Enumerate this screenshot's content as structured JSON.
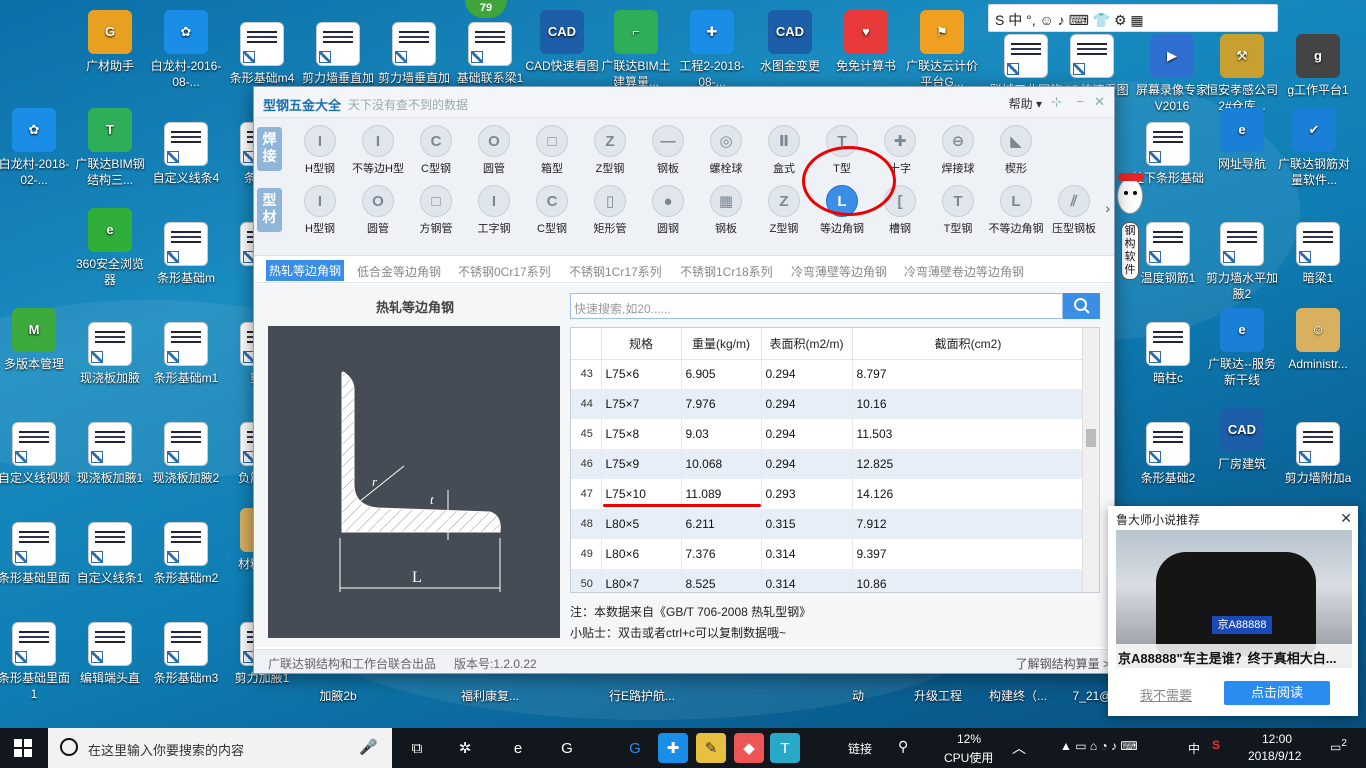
{
  "desktop_icons": [
    {
      "label": "广材助手",
      "color": "#e8a020",
      "glyph": "G"
    },
    {
      "label": "白龙村-2016-08-...",
      "color": "#1a8ee6",
      "glyph": "✿"
    },
    {
      "label": "条形基础m4",
      "thumb": true
    },
    {
      "label": "剪力墙垂直加腋2c",
      "thumb": true
    },
    {
      "label": "剪力墙垂直加腋2c",
      "thumb": true
    },
    {
      "label": "基础联系梁1",
      "thumb": true
    },
    {
      "label": "CAD快速看图",
      "color": "#1d5ea8",
      "glyph": "CAD"
    },
    {
      "label": "广联达BIM土建算量...",
      "color": "#2fae5a",
      "glyph": "⌐"
    },
    {
      "label": "工程2-2018-08-...",
      "color": "#1a8ee6",
      "glyph": "✚"
    },
    {
      "label": "水图金变更",
      "color": "#1d5ea8",
      "glyph": "CAD"
    },
    {
      "label": "免免计算书",
      "color": "#e83a3a",
      "glyph": "♥"
    },
    {
      "label": "广联达云计价平台G...",
      "color": "#f0a020",
      "glyph": "⚑"
    },
    {
      "label": "联城工业园施工图...",
      "thumb": true
    },
    {
      "label": "CAD快速看图",
      "thumb": true
    },
    {
      "label": "屏幕录像专家V2016",
      "color": "#2f6fd0",
      "glyph": "▶"
    },
    {
      "label": "恒安孝感公司2#仓库...",
      "color": "#c8a030",
      "glyph": "⚒"
    },
    {
      "label": "g工作平台1",
      "color": "#444",
      "glyph": "g"
    },
    {
      "label": "白龙村-2018-02-...",
      "color": "#1a8ee6",
      "glyph": "✿"
    },
    {
      "label": "广联达BIM钢结构三...",
      "color": "#2fae5a",
      "glyph": "T"
    },
    {
      "label": "自定义线条4",
      "thumb": true
    },
    {
      "label": "条形基",
      "thumb": true
    },
    {
      "label": "柱下条形基础",
      "thumb": true
    },
    {
      "label": "网址导航",
      "color": "#1a7fd6",
      "glyph": "e"
    },
    {
      "label": "广联达钢筋对量软件...",
      "color": "#1a7fd6",
      "glyph": "✔"
    },
    {
      "label": "360安全浏览器",
      "color": "#2fae3a",
      "glyph": "e"
    },
    {
      "label": "条形基础m",
      "thumb": true
    },
    {
      "label": "回",
      "thumb": true
    },
    {
      "label": "温度钢筋1",
      "thumb": true
    },
    {
      "label": "剪力墙水平加腋2",
      "thumb": true
    },
    {
      "label": "暗梁1",
      "thumb": true
    },
    {
      "label": "多版本管理",
      "color": "#3caa3c",
      "glyph": "M"
    },
    {
      "label": "现浇板加腋",
      "thumb": true
    },
    {
      "label": "条形基础m1",
      "thumb": true
    },
    {
      "label": "剪力",
      "thumb": true
    },
    {
      "label": "暗柱c",
      "thumb": true
    },
    {
      "label": "广联达--服务新干线",
      "color": "#1a7fd6",
      "glyph": "e"
    },
    {
      "label": "Administr...",
      "color": "#d8b060",
      "glyph": "☺"
    },
    {
      "label": "自定义线视频",
      "thumb": true
    },
    {
      "label": "现浇板加腋1",
      "thumb": true
    },
    {
      "label": "现浇板加腋2",
      "thumb": true
    },
    {
      "label": "负筋合支",
      "thumb": true
    },
    {
      "label": "条形基础2",
      "thumb": true
    },
    {
      "label": "厂房建筑",
      "color": "#1d5ea8",
      "glyph": "CAD"
    },
    {
      "label": "剪力墙附加a",
      "thumb": true
    },
    {
      "label": "条形基础里面",
      "thumb": true
    },
    {
      "label": "自定义线条1",
      "thumb": true
    },
    {
      "label": "条形基础m2",
      "thumb": true
    },
    {
      "label": "材料件板",
      "color": "#d8b060",
      "glyph": "▤"
    },
    {
      "label": "条形基础里面1",
      "thumb": true
    },
    {
      "label": "编辑端头直",
      "thumb": true
    },
    {
      "label": "条形基础m3",
      "thumb": true
    },
    {
      "label": "剪力加腋1",
      "thumb": true
    },
    {
      "label": "加腋2b",
      "thumb": false,
      "color": "transparent",
      "glyph": ""
    },
    {
      "label": "福利康复...",
      "thumb": false,
      "color": "transparent",
      "glyph": ""
    },
    {
      "label": "行E路护航...",
      "thumb": false,
      "color": "transparent",
      "glyph": ""
    },
    {
      "label": "动",
      "thumb": false,
      "color": "transparent",
      "glyph": ""
    },
    {
      "label": "升级工程",
      "thumb": false,
      "color": "transparent",
      "glyph": ""
    },
    {
      "label": "构建终（...",
      "thumb": false,
      "color": "transparent",
      "glyph": ""
    },
    {
      "label": "7_21@",
      "thumb": false,
      "color": "transparent",
      "glyph": ""
    }
  ],
  "update_badge": "79",
  "ime_bar": {
    "text": "S 中 °, ☺ ♪ ⌨ 👕 ⚙ ▦"
  },
  "app": {
    "title": "型钢五金大全",
    "subtitle": "天下没有查不到的数据",
    "help": "帮助 ▾",
    "win_buttons": {
      "pin": "⊹",
      "min": "−",
      "close": "✕"
    },
    "row1_tag": "焊接",
    "row2_tag": "型材",
    "row1": [
      {
        "label": "H型钢",
        "glyph": "I"
      },
      {
        "label": "不等边H型",
        "glyph": "I"
      },
      {
        "label": "C型钢",
        "glyph": "C"
      },
      {
        "label": "圆管",
        "glyph": "O"
      },
      {
        "label": "箱型",
        "glyph": "□"
      },
      {
        "label": "Z型钢",
        "glyph": "Z"
      },
      {
        "label": "钢板",
        "glyph": "—"
      },
      {
        "label": "螺栓球",
        "glyph": "◎"
      },
      {
        "label": "盒式",
        "glyph": "Ⅱ"
      },
      {
        "label": "T型",
        "glyph": "T"
      },
      {
        "label": "十字",
        "glyph": "✚"
      },
      {
        "label": "焊接球",
        "glyph": "⊖"
      },
      {
        "label": "楔形",
        "glyph": "◣"
      }
    ],
    "row2": [
      {
        "label": "H型钢",
        "glyph": "I"
      },
      {
        "label": "圆管",
        "glyph": "O"
      },
      {
        "label": "方钢管",
        "glyph": "□"
      },
      {
        "label": "工字钢",
        "glyph": "I"
      },
      {
        "label": "C型钢",
        "glyph": "C"
      },
      {
        "label": "矩形管",
        "glyph": "▯"
      },
      {
        "label": "圆钢",
        "glyph": "●"
      },
      {
        "label": "钢板",
        "glyph": "▦"
      },
      {
        "label": "Z型钢",
        "glyph": "Z"
      },
      {
        "label": "等边角钢",
        "glyph": "L",
        "selected": true
      },
      {
        "label": "槽钢",
        "glyph": "["
      },
      {
        "label": "T型钢",
        "glyph": "T"
      },
      {
        "label": "不等边角钢",
        "glyph": "L"
      },
      {
        "label": "压型钢板",
        "glyph": "⫽"
      }
    ],
    "subtabs": [
      "热轧等边角钢",
      "低合金等边角钢",
      "不锈钢0Cr17系列",
      "不锈钢1Cr17系列",
      "不锈钢1Cr18系列",
      "冷弯薄壁等边角钢",
      "冷弯薄壁卷边等边角钢"
    ],
    "active_subtab": "热轧等边角钢",
    "section_title": "热轧等边角钢",
    "diagram_labels": {
      "r": "r",
      "t": "t",
      "L": "L"
    },
    "search_placeholder": "快速搜索,如20......",
    "table": {
      "headers": [
        "规格",
        "重量(kg/m)",
        "表面积(m2/m)",
        "截面积(cm2)"
      ],
      "rows": [
        {
          "idx": "43",
          "spec": "L75×6",
          "weight": "6.905",
          "area": "0.294",
          "section": "8.797"
        },
        {
          "idx": "44",
          "spec": "L75×7",
          "weight": "7.976",
          "area": "0.294",
          "section": "10.16"
        },
        {
          "idx": "45",
          "spec": "L75×8",
          "weight": "9.03",
          "area": "0.294",
          "section": "11.503"
        },
        {
          "idx": "46",
          "spec": "L75×9",
          "weight": "10.068",
          "area": "0.294",
          "section": "12.825"
        },
        {
          "idx": "47",
          "spec": "L75×10",
          "weight": "11.089",
          "area": "0.293",
          "section": "14.126"
        },
        {
          "idx": "48",
          "spec": "L80×5",
          "weight": "6.211",
          "area": "0.315",
          "section": "7.912"
        },
        {
          "idx": "49",
          "spec": "L80×6",
          "weight": "7.376",
          "area": "0.314",
          "section": "9.397"
        },
        {
          "idx": "50",
          "spec": "L80×7",
          "weight": "8.525",
          "area": "0.314",
          "section": "10.86"
        }
      ]
    },
    "note": "注：本数据来自《GB/T  706-2008  热轧型钢》",
    "tip": "小贴士：双击或者ctrl+c可以复制数据哦~",
    "footer_left": "广联达钢结构和工作台联合出品",
    "footer_version": "版本号:1.2.0.22",
    "footer_right": "了解钢结构算量 >"
  },
  "mascot_text": "钢构软件",
  "popup": {
    "title": "鲁大师小说推荐",
    "plate": "京A88888",
    "caption": "京A88888\"车主是谁？终于真相大白...",
    "no": "我不需要",
    "yes": "点击阅读",
    "close": "✕"
  },
  "taskbar": {
    "search": "在这里输入你要搜索的内容",
    "link": "链接",
    "cpu_pct": "12%",
    "cpu_label": "CPU使用",
    "lang": "中",
    "time": "12:00",
    "date": "2018/9/12",
    "notif": "2"
  }
}
